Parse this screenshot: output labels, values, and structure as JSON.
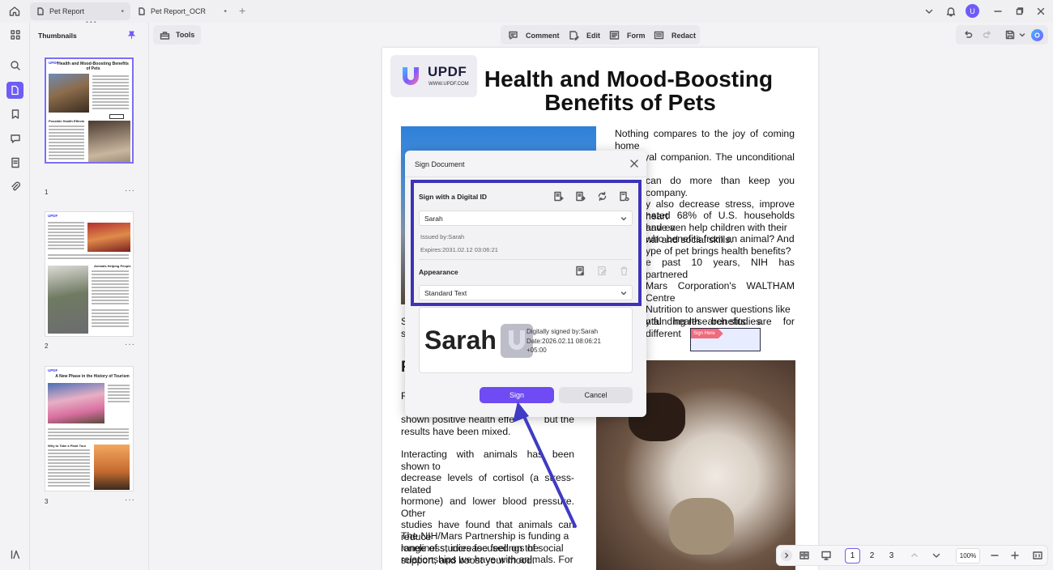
{
  "tabs": [
    {
      "label": "Pet Report"
    },
    {
      "label": "Pet Report_OCR"
    }
  ],
  "user_initial": "U",
  "left_panel": {
    "title": "Thumbnails",
    "pages": [
      "1",
      "2",
      "3"
    ],
    "thumb1": {
      "title": "Health and Mood-Boosting Benefits of Pets",
      "heading": "Possible Health Effects"
    },
    "thumb2": {
      "heading": "Animals Helping People"
    },
    "thumb3": {
      "title": "A New Phase in the History of Tourism",
      "heading": "Why to Take a Plant Tour"
    },
    "logo": "UPDF"
  },
  "toolbar": {
    "tools": "Tools",
    "comment": "Comment",
    "edit": "Edit",
    "form": "Form",
    "redact": "Redact"
  },
  "document": {
    "logo_text": "UPDF",
    "logo_url": "WWW.UPDF.COM",
    "title_line1": "Health and Mood-Boosting",
    "title_line2": "Benefits of Pets",
    "p1_lines": [
      "Nothing compares to the joy of coming home",
      "to a loyal companion. The unconditional love",
      "can do more than keep you company.",
      "y also decrease stress, improve heart",
      "and even help children with their",
      "nal and social skills."
    ],
    "p2_lines": [
      "nated 68% of U.S. households have a",
      "who benefits from an animal? And",
      "ype of pet brings health benefits?"
    ],
    "p3_lines": [
      "e past 10 years, NIH has partnered",
      "Mars Corporation's WALTHAM Centre",
      "Nutrition to answer questions like",
      "y funding research studies."
    ],
    "p4_line": "ntal health benefits are for different",
    "left_frag_s1": "S",
    "left_frag_s2": "s",
    "left_frag_f": "F",
    "left_frag_r": "R",
    "pA_line1": "shown  positive  health  effe",
    "pA_line1b": "but  the",
    "pA_line2": "results have been mixed.",
    "pB_lines": [
      "Interacting with animals has been shown to",
      "decrease levels of cortisol (a stress-related",
      "hormone) and lower blood pressure. Other",
      "studies have found that animals can reduce",
      "loneliness,  increase  feelings  of  social",
      "support, and boost your mood."
    ],
    "pC_lines": [
      "The  NIH/Mars  Partnership  is  funding  a",
      "range  of  studies  focused  on  the",
      "relationships  we  have  with  animals.  For"
    ],
    "sign_here": "Sign Here"
  },
  "dialog": {
    "title": "Sign Document",
    "section_digital_id": "Sign with a Digital ID",
    "id_name": "Sarah",
    "issued_by": "Issued by:Sarah",
    "expires": "Expires:2031.02.12 03:06:21",
    "section_appearance": "Appearance",
    "appearance_value": "Standard Text",
    "preview_name": "Sarah",
    "preview_line1": "Digitally signed by:Sarah",
    "preview_line2": "Date:2026.02.11 08:06:21",
    "preview_line3": "+05:00",
    "sign_button": "Sign",
    "cancel_button": "Cancel"
  },
  "bottom_bar": {
    "pages": [
      "1",
      "2",
      "3"
    ],
    "zoom": "100%"
  },
  "colors": {
    "accent": "#6e5cf6",
    "highlight_border": "#3c33b8",
    "arrow": "#3f3bc2"
  }
}
